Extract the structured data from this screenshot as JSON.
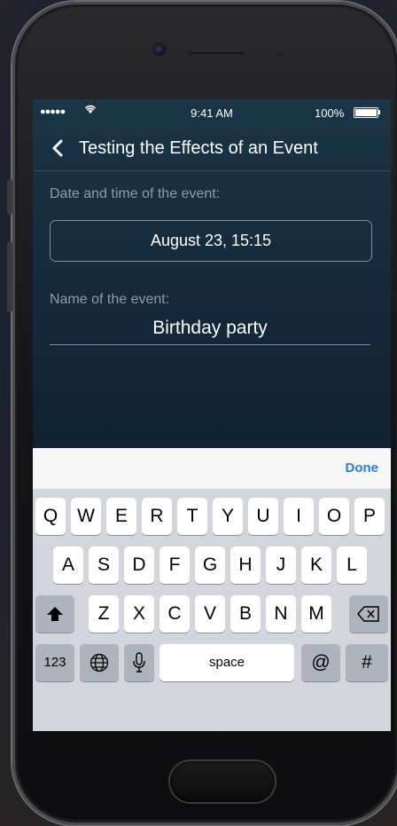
{
  "status_bar": {
    "signal": "●●●●●",
    "time": "9:41 AM",
    "battery": "100%"
  },
  "nav": {
    "title": "Testing the Effects of an Event"
  },
  "form": {
    "date_label": "Date and time of the event:",
    "date_value": "August 23, 15:15",
    "name_label": "Name of the event:",
    "name_value": "Birthday party"
  },
  "accessory": {
    "done": "Done"
  },
  "keyboard": {
    "row1": [
      "Q",
      "W",
      "E",
      "R",
      "T",
      "Y",
      "U",
      "I",
      "O",
      "P"
    ],
    "row2": [
      "A",
      "S",
      "D",
      "F",
      "G",
      "H",
      "J",
      "K",
      "L"
    ],
    "row3": [
      "Z",
      "X",
      "C",
      "V",
      "B",
      "N",
      "M"
    ],
    "numbers": "123",
    "space": "space",
    "at": "@",
    "hash": "#"
  },
  "colors": {
    "accent": "#2f7bd6",
    "screen_bg": "#142a3c",
    "keyboard_bg": "#d2d5db"
  }
}
